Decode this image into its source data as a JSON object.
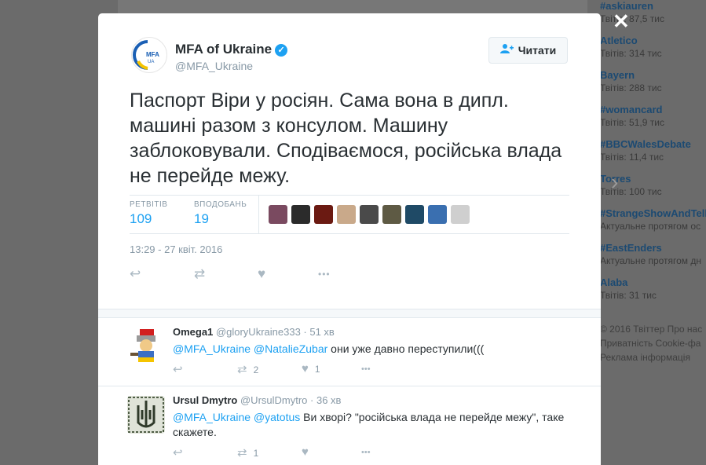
{
  "background": {
    "trends": [
      {
        "name": "#askiauren",
        "sub": "Твітів: 87,5 тис"
      },
      {
        "name": "Atletico",
        "sub": "Твітів: 314 тис"
      },
      {
        "name": "Bayern",
        "sub": "Твітів: 288 тис"
      },
      {
        "name": "#womancard",
        "sub": "Твітів: 51,9 тис"
      },
      {
        "name": "#BBCWalesDebate",
        "sub": "Твітів: 11,4 тис"
      },
      {
        "name": "Torres",
        "sub": "Твітів: 100 тис"
      },
      {
        "name": "#StrangeShowAndTell",
        "sub": "Актуальне протягом ос"
      },
      {
        "name": "#EastEnders",
        "sub": "Актуальне протягом дн"
      },
      {
        "name": "Alaba",
        "sub": "Твітів: 31 тис"
      }
    ],
    "footer": [
      "© 2016 Твіттер   Про нас",
      "Приватність   Cookie-фа",
      "Реклама інформація"
    ]
  },
  "modal": {
    "close_glyph": "✕",
    "next_glyph": "›",
    "author": {
      "name": "MFA of Ukraine",
      "handle": "@MFA_Ukraine",
      "verified_icon": "✓",
      "logo_text": "MFA",
      "logo_subtext": "UA"
    },
    "follow_button": {
      "label": "Читати",
      "icon": "follow-icon"
    },
    "text": "Паспорт Віри у росіян. Сама вона в дипл. машині разом з консулом. Машину заблоковували. Сподіваємося, російська влада не перейде межу.",
    "stats": {
      "retweets_label": "РЕТВІТІВ",
      "retweets": "109",
      "likes_label": "ВПОДОБАНЬ",
      "likes": "19"
    },
    "likers": [
      {
        "color": "#7a4a60"
      },
      {
        "color": "#2b2b2b"
      },
      {
        "color": "#6b1a12"
      },
      {
        "color": "#c9a98a"
      },
      {
        "color": "#4a4a4a"
      },
      {
        "color": "#5e5a44"
      },
      {
        "color": "#1f4a66"
      },
      {
        "color": "#3a6fb0"
      },
      {
        "color": "#cfcfcf"
      }
    ],
    "timestamp": "13:29 - 27 квіт. 2016",
    "actions": {
      "reply": "↩",
      "retweet": "⇄",
      "like": "♥",
      "more": "•••"
    }
  },
  "replies": [
    {
      "name": "Omega1",
      "handle": "@gloryUkraine333",
      "time": "· 51 хв",
      "mentions": "@MFA_Ukraine @NatalieZubar",
      "text": " они уже давно переступили(((",
      "retweets": "2",
      "likes": "1"
    },
    {
      "name": "Ursul Dmytro",
      "handle": "@UrsulDmytro",
      "time": "· 36 хв",
      "mentions": "@MFA_Ukraine @yatotus",
      "text": " Ви хворі? \"російська влада не перейде межу\", таке скажете.",
      "retweets": "1",
      "likes": ""
    }
  ]
}
